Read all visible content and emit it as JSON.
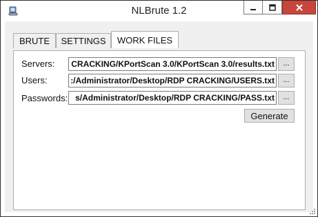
{
  "window": {
    "title": "NLBrute 1.2",
    "icons": {
      "app": "app-icon",
      "minimize": "minimize-icon",
      "maximize": "maximize-icon",
      "close": "close-icon",
      "resize": "resize-grip-icon"
    },
    "close_color": "#c7463c"
  },
  "tabs": [
    {
      "label": "BRUTE",
      "active": false
    },
    {
      "label": "SETTINGS",
      "active": false
    },
    {
      "label": "WORK FILES",
      "active": true
    }
  ],
  "work_files": {
    "servers": {
      "label": "Servers:",
      "value": "CRACKING/KPortScan 3.0/KPortScan 3.0/results.txt",
      "browse_label": "..."
    },
    "users": {
      "label": "Users:",
      "value": ":/Administrator/Desktop/RDP CRACKING/USERS.txt",
      "browse_label": "..."
    },
    "passwords": {
      "label": "Passwords:",
      "value": "s/Administrator/Desktop/RDP CRACKING/PASS.txt",
      "browse_label": "..."
    },
    "generate_label": "Generate"
  }
}
